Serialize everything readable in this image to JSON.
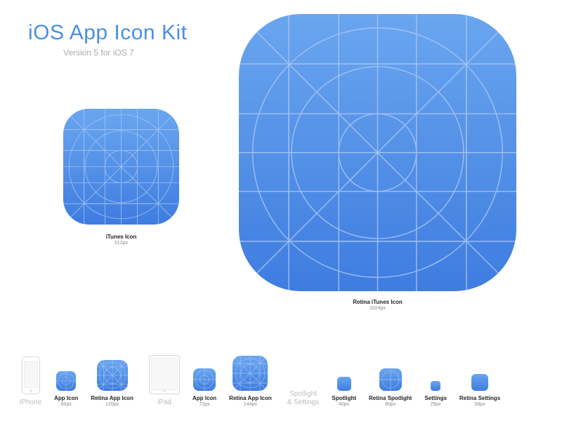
{
  "title": "iOS App Icon Kit",
  "subtitle": "Version 5 for iOS 7",
  "itunes": {
    "label": "iTunes Icon",
    "size": "512px"
  },
  "retina_itunes": {
    "label": "Retina iTunes Icon",
    "size": "1024px"
  },
  "sections": {
    "iphone": "iPhone",
    "ipad": "iPad",
    "spotlight": "Spotlight\n& Settings"
  },
  "iphone": {
    "app": {
      "label": "App Icon",
      "size": "60px"
    },
    "retina_app": {
      "label": "Retina App Icon",
      "size": "120px"
    }
  },
  "ipad": {
    "app": {
      "label": "App Icon",
      "size": "72px"
    },
    "retina_app": {
      "label": "Retina App Icon",
      "size": "144px"
    }
  },
  "spotlight": {
    "spotlight": {
      "label": "Spotlight",
      "size": "40px"
    },
    "retina_spotlight": {
      "label": "Retina Spotlight",
      "size": "80px"
    },
    "settings": {
      "label": "Settings",
      "size": "29px"
    },
    "retina_settings": {
      "label": "Retina Settings",
      "size": "58px"
    }
  }
}
